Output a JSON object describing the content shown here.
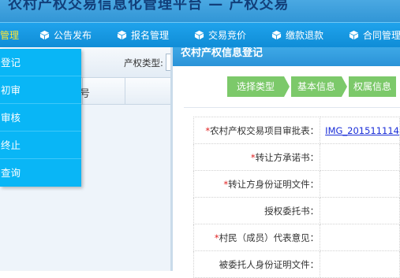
{
  "banner": {
    "title": "农村产权交易信息化管理平台 — 产权交易"
  },
  "nav": {
    "items": [
      {
        "label": "管理",
        "active": true
      },
      {
        "label": "公告发布"
      },
      {
        "label": "报名管理"
      },
      {
        "label": "交易竞价"
      },
      {
        "label": "缴款退款"
      },
      {
        "label": "合同管理"
      }
    ]
  },
  "dropdown": {
    "items": [
      "登记",
      "初审",
      "审核",
      "终止",
      "查询"
    ]
  },
  "left_panel": {
    "filter_label": "产权类型:",
    "table_header_fragment": "号"
  },
  "main": {
    "title": "农村产权信息登记",
    "steps": [
      "选择类型",
      "基本信息",
      "权属信息"
    ],
    "form": [
      {
        "label": "农村产权交易项目审批表：",
        "required": true,
        "value": "IMG_201511114"
      },
      {
        "label": "转让方承诺书：",
        "required": true,
        "value": ""
      },
      {
        "label": "转让方身份证明文件：",
        "required": true,
        "value": ""
      },
      {
        "label": "授权委托书：",
        "required": false,
        "value": ""
      },
      {
        "label": "村民（成员）代表意见：",
        "required": true,
        "value": ""
      },
      {
        "label": "被委托人身份证明文件：",
        "required": false,
        "value": ""
      }
    ]
  },
  "colors": {
    "nav_bg": "#1799e4",
    "dropdown_bg": "#09b6f6",
    "step_bg": "#7cc96a",
    "required": "#e02020",
    "link": "#1a2ed8"
  }
}
